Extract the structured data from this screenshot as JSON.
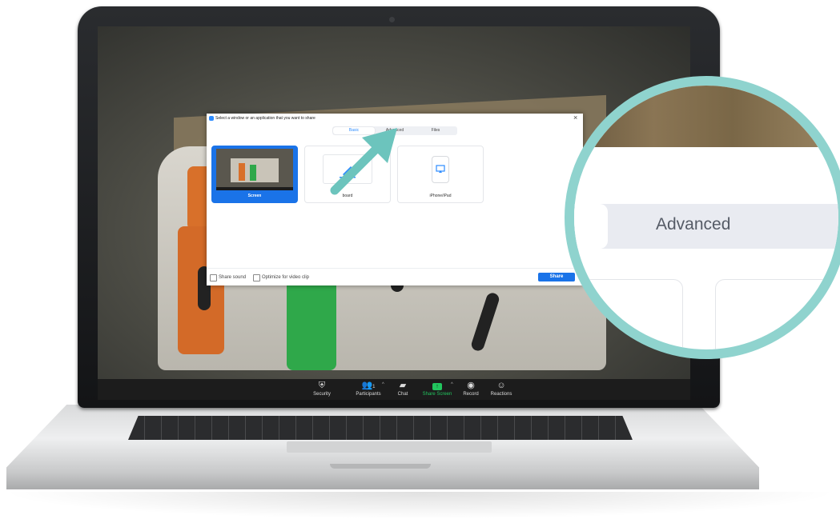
{
  "dialog": {
    "title": "Select a window or an application that you want to share",
    "tabs": [
      {
        "label": "Basic",
        "active": true
      },
      {
        "label": "Advanced",
        "active": false
      },
      {
        "label": "Files",
        "active": false
      }
    ],
    "tiles": [
      {
        "label": "Screen",
        "selected": true
      },
      {
        "label": "board",
        "selected": false
      },
      {
        "label": "iPhone/iPad",
        "selected": false
      }
    ],
    "footer": {
      "share_sound": "Share sound",
      "optimize_video": "Optimize for video clip",
      "share_button": "Share"
    }
  },
  "toolbar": {
    "items": [
      {
        "label": "Security",
        "icon": "shield-icon"
      },
      {
        "label": "Participants",
        "icon": "participants-icon",
        "count": "1"
      },
      {
        "label": "Chat",
        "icon": "chat-icon"
      },
      {
        "label": "Share Screen",
        "icon": "share-screen-icon"
      },
      {
        "label": "Record",
        "icon": "record-icon"
      },
      {
        "label": "Reactions",
        "icon": "reactions-icon"
      }
    ]
  },
  "magnifier": {
    "label": "Advanced"
  },
  "colors": {
    "accent": "#1a73e8",
    "share_green": "#22c55e",
    "magnifier_ring": "#8fd3ce",
    "arrow": "#6cc4bd"
  }
}
